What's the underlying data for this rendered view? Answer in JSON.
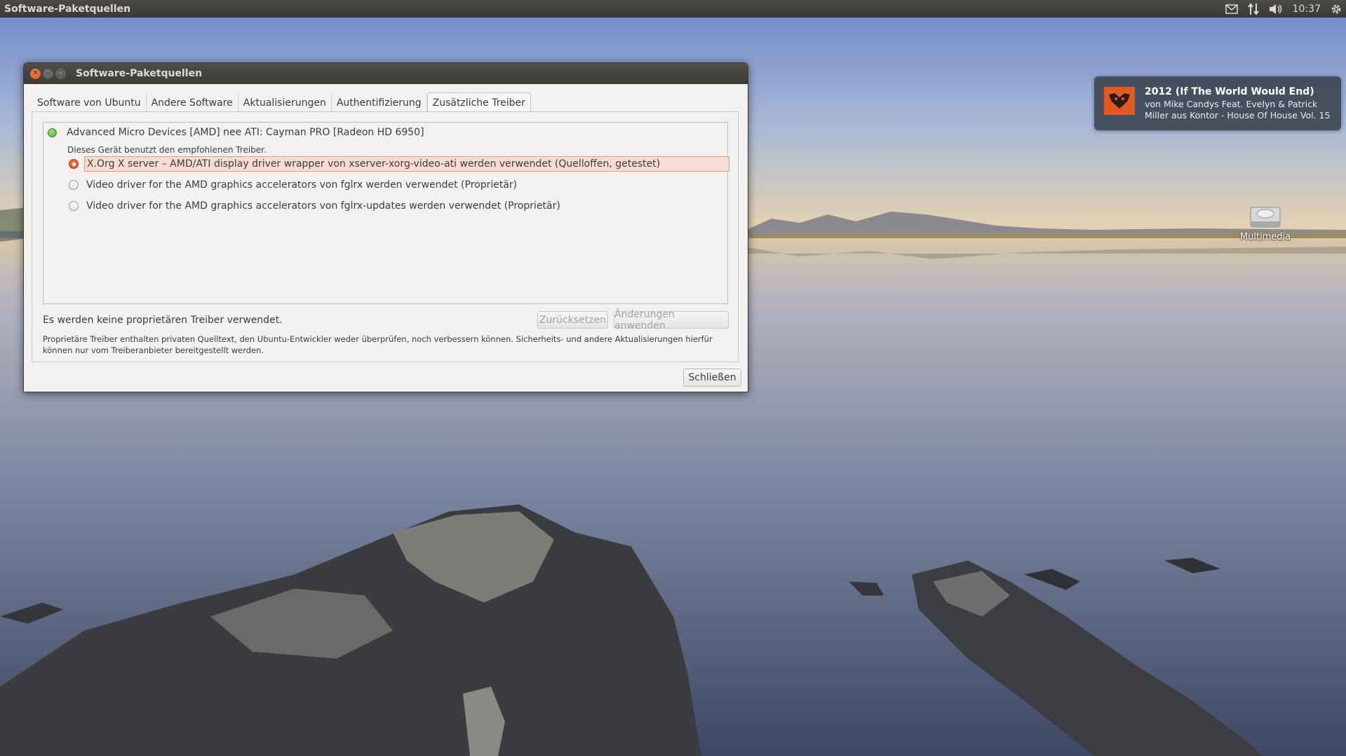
{
  "panel": {
    "app_title": "Software-Paketquellen",
    "clock": "10:37",
    "icons": [
      "mail-icon",
      "network-icon",
      "volume-icon",
      "settings-gear-icon"
    ]
  },
  "window": {
    "title": "Software-Paketquellen",
    "tabs": [
      {
        "label": "Software von Ubuntu",
        "active": false
      },
      {
        "label": "Andere Software",
        "active": false
      },
      {
        "label": "Aktualisierungen",
        "active": false
      },
      {
        "label": "Authentifizierung",
        "active": false
      },
      {
        "label": "Zusätzliche Treiber",
        "active": true
      }
    ],
    "device": {
      "name": "Advanced Micro Devices [AMD] nee ATI: Cayman PRO [Radeon HD 6950]",
      "note": "Dieses Gerät benutzt den empfohlenen Treiber.",
      "options": [
        {
          "label": "X.Org X server – AMD/ATI display driver wrapper von xserver-xorg-video-ati werden verwendet (Quelloffen, getestet)",
          "selected": true
        },
        {
          "label": "Video driver for the AMD graphics accelerators von fglrx werden verwendet (Proprietär)",
          "selected": false
        },
        {
          "label": "Video driver for the AMD graphics accelerators von fglrx-updates werden verwendet (Proprietär)",
          "selected": false
        }
      ]
    },
    "status_text": "Es werden keine proprietären Treiber verwendet.",
    "reset_label": "Zurücksetzen",
    "apply_label": "Änderungen anwenden",
    "info_text": "Proprietäre Treiber enthalten privaten Quelltext, den Ubuntu-Entwickler weder überprüfen, noch verbessern können. Sicherheits- und andere Aktualisierungen hierfür können nur vom Treiberanbieter bereitgestellt werden.",
    "close_label": "Schließen"
  },
  "notification": {
    "title": "2012 (If The World Would End)",
    "body": "von Mike Candys Feat. Evelyn & Patrick Miller aus Kontor - House Of House Vol. 15"
  },
  "desktop": {
    "icon_label": "Multimedia"
  },
  "colors": {
    "accent": "#dd4814",
    "panel_bg": "#3c3b37",
    "window_bg": "#f2f1f0",
    "selection_bg": "#f6dcd2"
  }
}
